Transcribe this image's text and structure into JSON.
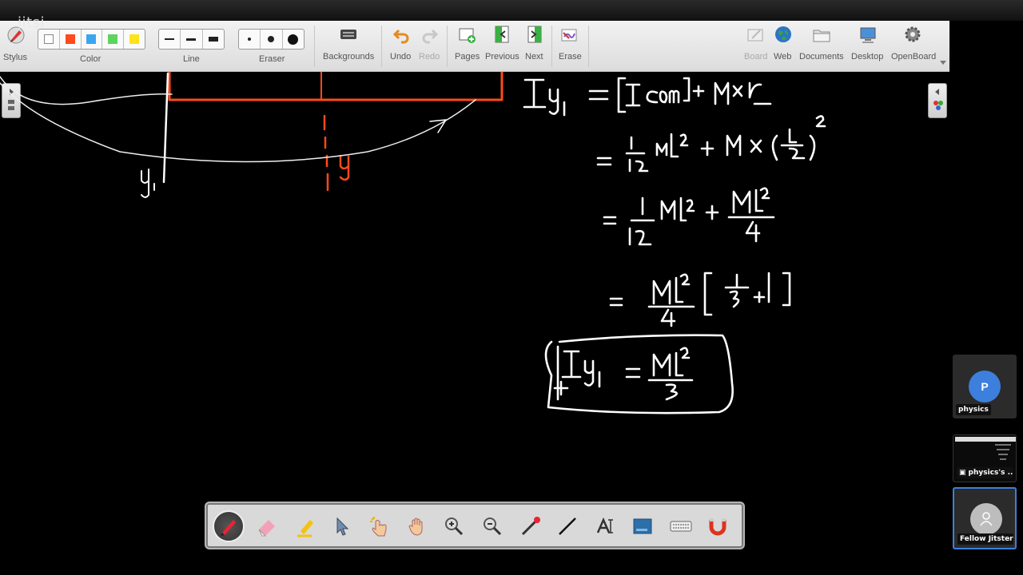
{
  "app": {
    "brand": "jitsi"
  },
  "toolbar": {
    "stylus_label": "Stylus",
    "color_label": "Color",
    "line_label": "Line",
    "eraser_label": "Eraser",
    "backgrounds_label": "Backgrounds",
    "undo_label": "Undo",
    "redo_label": "Redo",
    "pages_label": "Pages",
    "previous_label": "Previous",
    "next_label": "Next",
    "erase_label": "Erase",
    "board_label": "Board",
    "web_label": "Web",
    "documents_label": "Documents",
    "desktop_label": "Desktop",
    "openboard_label": "OpenBoard",
    "colors": [
      "#ffffff",
      "#ff4a1c",
      "#3ba6f0",
      "#5ed35e",
      "#ffe21a"
    ]
  },
  "participants": [
    {
      "name": "physics",
      "avatar_letter": "P",
      "avatar_color": "#3d7fdc"
    },
    {
      "name": "physics's ..."
    },
    {
      "name": "Fellow Jitster"
    }
  ],
  "floating_tools": [
    "pen-tool",
    "eraser-tool",
    "highlighter-tool",
    "selector-tool",
    "interactive-tool",
    "hand-tool",
    "zoom-in-tool",
    "zoom-out-tool",
    "laser-pointer-tool",
    "line-tool",
    "text-tool",
    "capture-tool",
    "keyboard-tool",
    "magnet-tool"
  ]
}
